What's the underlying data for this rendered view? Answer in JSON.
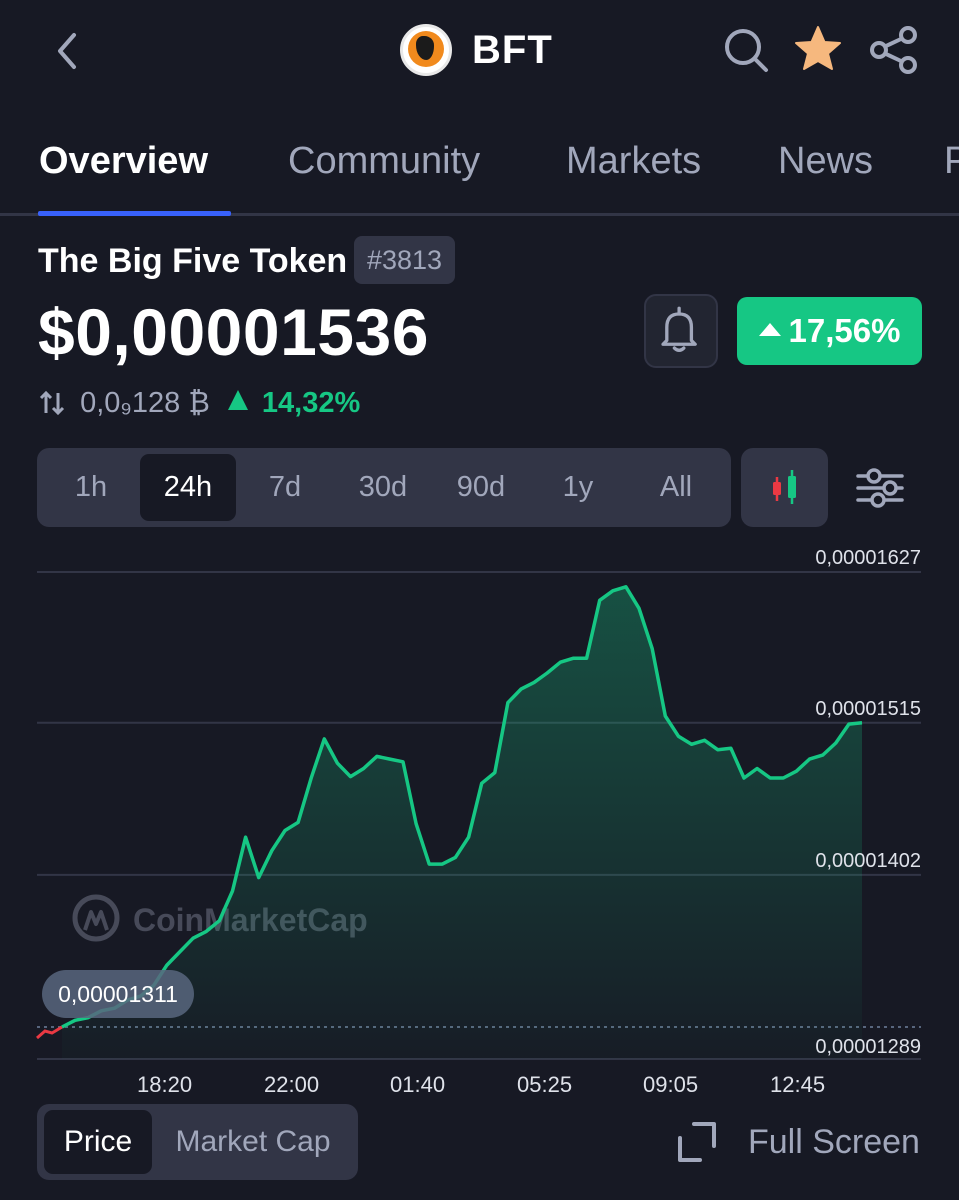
{
  "header": {
    "symbol": "BFT",
    "logo_icon": "big-five-token-logo",
    "icons": [
      "back-arrow-icon",
      "search-icon",
      "star-icon",
      "share-icon"
    ]
  },
  "tabs": [
    {
      "label": "Overview",
      "active": true
    },
    {
      "label": "Community",
      "active": false
    },
    {
      "label": "Markets",
      "active": false
    },
    {
      "label": "News",
      "active": false
    },
    {
      "label": "P",
      "active": false
    }
  ],
  "coin": {
    "name": "The Big Five Token",
    "rank": "#3813",
    "price": "$0,00001536",
    "change_24h": "17,56%",
    "btc_price": "0,0₉128 ₿",
    "btc_change": "14,32%"
  },
  "colors": {
    "background": "#171924",
    "accent": "#3861fb",
    "positive": "#16c784",
    "negative": "#ea3943",
    "star": "#f6b87e"
  },
  "ranges": [
    {
      "label": "1h",
      "active": false
    },
    {
      "label": "24h",
      "active": true
    },
    {
      "label": "7d",
      "active": false
    },
    {
      "label": "30d",
      "active": false
    },
    {
      "label": "90d",
      "active": false
    },
    {
      "label": "1y",
      "active": false
    },
    {
      "label": "All",
      "active": false
    }
  ],
  "chart_data": {
    "type": "area",
    "watermark": "CoinMarketCap",
    "y_ticks": [
      "0,00001627",
      "0,00001515",
      "0,00001402",
      "0,00001289"
    ],
    "x_ticks": [
      "18:20",
      "22:00",
      "01:40",
      "05:25",
      "09:05",
      "12:45"
    ],
    "ylim": [
      1.289e-05,
      1.627e-05
    ],
    "open_label": "0,00001311",
    "grid": true,
    "series": [
      {
        "values": [
          1.289e-05,
          1.294e-05,
          1.296e-05,
          1.301e-05,
          1.303e-05,
          1.309e-05,
          1.312e-05,
          1.32e-05,
          1.335e-05,
          1.345e-05,
          1.355e-05,
          1.36e-05,
          1.368e-05,
          1.39e-05,
          1.43e-05,
          1.4e-05,
          1.42e-05,
          1.435e-05,
          1.441e-05,
          1.474e-05,
          1.503e-05,
          1.485e-05,
          1.475e-05,
          1.481e-05,
          1.49e-05,
          1.488e-05,
          1.486e-05,
          1.44e-05,
          1.41e-05,
          1.41e-05,
          1.415e-05,
          1.43e-05,
          1.47e-05,
          1.478e-05,
          1.53e-05,
          1.54e-05,
          1.545e-05,
          1.552e-05,
          1.56e-05,
          1.563e-05,
          1.563e-05,
          1.606e-05,
          1.613e-05,
          1.616e-05,
          1.6e-05,
          1.57e-05,
          1.52e-05,
          1.505e-05,
          1.499e-05,
          1.502e-05,
          1.495e-05,
          1.496e-05,
          1.474e-05,
          1.481e-05,
          1.474e-05,
          1.474e-05,
          1.479e-05,
          1.488e-05,
          1.491e-05,
          1.5e-05,
          1.514e-05,
          1.515e-05
        ]
      }
    ]
  },
  "chart_controls": {
    "toggle": [
      {
        "label": "Price",
        "active": true
      },
      {
        "label": "Market Cap",
        "active": false
      }
    ],
    "fullscreen_label": "Full Screen"
  }
}
